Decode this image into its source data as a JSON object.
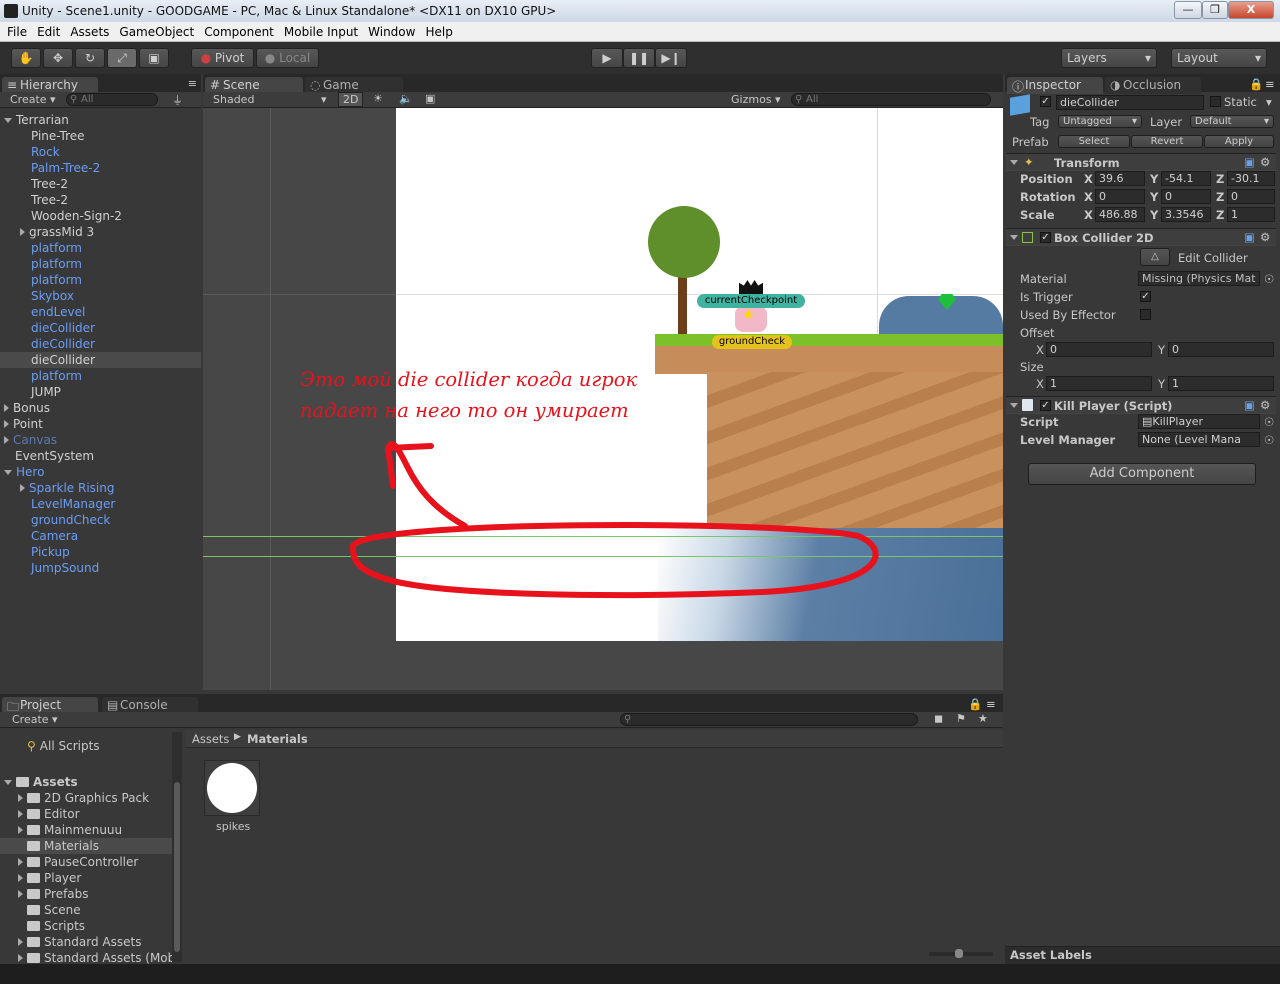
{
  "window": {
    "title": "Unity - Scene1.unity - GOODGAME - PC, Mac & Linux Standalone* <DX11 on DX10 GPU>"
  },
  "menu": [
    "File",
    "Edit",
    "Assets",
    "GameObject",
    "Component",
    "Mobile Input",
    "Window",
    "Help"
  ],
  "toolbar": {
    "pivot": "Pivot",
    "local": "Local",
    "layers": "Layers",
    "layout": "Layout"
  },
  "hierarchy": {
    "tab": "Hierarchy",
    "create": "Create",
    "search_placeholder": "All",
    "items": [
      {
        "label": "Terrarian",
        "indent": 0,
        "expand": "open",
        "color": "white"
      },
      {
        "label": "Pine-Tree",
        "indent": 1,
        "expand": "none",
        "color": "white"
      },
      {
        "label": "Rock",
        "indent": 1,
        "expand": "none",
        "color": "blue"
      },
      {
        "label": "Palm-Tree-2",
        "indent": 1,
        "expand": "none",
        "color": "blue"
      },
      {
        "label": "Tree-2",
        "indent": 1,
        "expand": "none",
        "color": "white"
      },
      {
        "label": "Tree-2",
        "indent": 1,
        "expand": "none",
        "color": "white"
      },
      {
        "label": "Wooden-Sign-2",
        "indent": 1,
        "expand": "none",
        "color": "white"
      },
      {
        "label": "grassMid 3",
        "indent": 1,
        "expand": "closed",
        "color": "white"
      },
      {
        "label": "platform",
        "indent": 1,
        "expand": "none",
        "color": "blue"
      },
      {
        "label": "platform",
        "indent": 1,
        "expand": "none",
        "color": "blue"
      },
      {
        "label": "platform",
        "indent": 1,
        "expand": "none",
        "color": "blue"
      },
      {
        "label": "Skybox",
        "indent": 1,
        "expand": "none",
        "color": "blue"
      },
      {
        "label": "endLevel",
        "indent": 1,
        "expand": "none",
        "color": "blue"
      },
      {
        "label": "dieCollider",
        "indent": 1,
        "expand": "none",
        "color": "blue"
      },
      {
        "label": "dieCollider",
        "indent": 1,
        "expand": "none",
        "color": "blue"
      },
      {
        "label": "dieCollider",
        "indent": 1,
        "expand": "none",
        "color": "white",
        "selected": true
      },
      {
        "label": "platform",
        "indent": 1,
        "expand": "none",
        "color": "blue"
      },
      {
        "label": "JUMP",
        "indent": 1,
        "expand": "none",
        "color": "white"
      },
      {
        "label": "Bonus",
        "indent": 0,
        "expand": "closed",
        "color": "white"
      },
      {
        "label": "Point",
        "indent": 0,
        "expand": "closed",
        "color": "white"
      },
      {
        "label": "Canvas",
        "indent": 0,
        "expand": "closed",
        "color": "dim"
      },
      {
        "label": "EventSystem",
        "indent": 0,
        "expand": "none",
        "color": "white"
      },
      {
        "label": "Hero",
        "indent": 0,
        "expand": "open",
        "color": "blue"
      },
      {
        "label": "Sparkle Rising",
        "indent": 1,
        "expand": "closed",
        "color": "blue"
      },
      {
        "label": "LevelManager",
        "indent": 1,
        "expand": "none",
        "color": "blue"
      },
      {
        "label": "groundCheck",
        "indent": 1,
        "expand": "none",
        "color": "blue"
      },
      {
        "label": "Camera",
        "indent": 1,
        "expand": "none",
        "color": "blue"
      },
      {
        "label": "Pickup",
        "indent": 1,
        "expand": "none",
        "color": "blue"
      },
      {
        "label": "JumpSound",
        "indent": 1,
        "expand": "none",
        "color": "blue"
      }
    ]
  },
  "scene": {
    "tab": "Scene",
    "game_tab": "Game",
    "shading": "Shaded",
    "mode_2d": "2D",
    "gizmos": "Gizmos",
    "search_placeholder": "All",
    "labels": {
      "checkpoint": "currentCheckpoint",
      "groundcheck": "groundCheck"
    },
    "annotation": {
      "line1": "Это мой die collider когда игрок",
      "line2": "падает на него то он умирает",
      "color": "#e8121c"
    }
  },
  "inspector": {
    "tab": "Inspector",
    "occlusion_tab": "Occlusion",
    "object_name": "dieCollider",
    "static_label": "Static",
    "tag_label": "Tag",
    "tag_value": "Untagged",
    "layer_label": "Layer",
    "layer_value": "Default",
    "prefab_label": "Prefab",
    "prefab_select": "Select",
    "prefab_revert": "Revert",
    "prefab_apply": "Apply",
    "transform": {
      "title": "Transform",
      "position_label": "Position",
      "rotation_label": "Rotation",
      "scale_label": "Scale",
      "position": {
        "x": "39.6",
        "y": "-54.1",
        "z": "-30.1"
      },
      "rotation": {
        "x": "0",
        "y": "0",
        "z": "0"
      },
      "scale": {
        "x": "486.88",
        "y": "3.3546",
        "z": "1"
      }
    },
    "box_collider": {
      "title": "Box Collider 2D",
      "edit_collider": "Edit Collider",
      "material_label": "Material",
      "material_value": "Missing (Physics Mat",
      "is_trigger_label": "Is Trigger",
      "used_by_effector_label": "Used By Effector",
      "offset_label": "Offset",
      "offset_x": "0",
      "offset_y": "0",
      "size_label": "Size",
      "size_x": "1",
      "size_y": "1"
    },
    "kill_player": {
      "title": "Kill Player (Script)",
      "script_label": "Script",
      "script_value": "KillPlayer",
      "level_manager_label": "Level Manager",
      "level_manager_value": "None (Level Mana"
    },
    "add_component": "Add Component"
  },
  "project": {
    "tab": "Project",
    "console_tab": "Console",
    "create": "Create",
    "tree": [
      {
        "label": "All Scripts",
        "indent": 1,
        "type": "search"
      },
      {
        "label": "Assets",
        "indent": 0,
        "type": "folder-open",
        "bold": true
      },
      {
        "label": "2D Graphics Pack",
        "indent": 1,
        "type": "folder-closed"
      },
      {
        "label": "Editor",
        "indent": 1,
        "type": "folder-closed"
      },
      {
        "label": "Mainmenuuu",
        "indent": 1,
        "type": "folder-closed"
      },
      {
        "label": "Materials",
        "indent": 1,
        "type": "folder",
        "selected": true
      },
      {
        "label": "PauseController",
        "indent": 1,
        "type": "folder-closed"
      },
      {
        "label": "Player",
        "indent": 1,
        "type": "folder-closed"
      },
      {
        "label": "Prefabs",
        "indent": 1,
        "type": "folder-closed"
      },
      {
        "label": "Scene",
        "indent": 1,
        "type": "folder"
      },
      {
        "label": "Scripts",
        "indent": 1,
        "type": "folder"
      },
      {
        "label": "Standard Assets",
        "indent": 1,
        "type": "folder-closed"
      },
      {
        "label": "Standard Assets (Mob",
        "indent": 1,
        "type": "folder-closed"
      }
    ],
    "breadcrumb_root": "Assets",
    "breadcrumb_current": "Materials",
    "asset_name": "spikes",
    "asset_labels": "Asset Labels"
  }
}
